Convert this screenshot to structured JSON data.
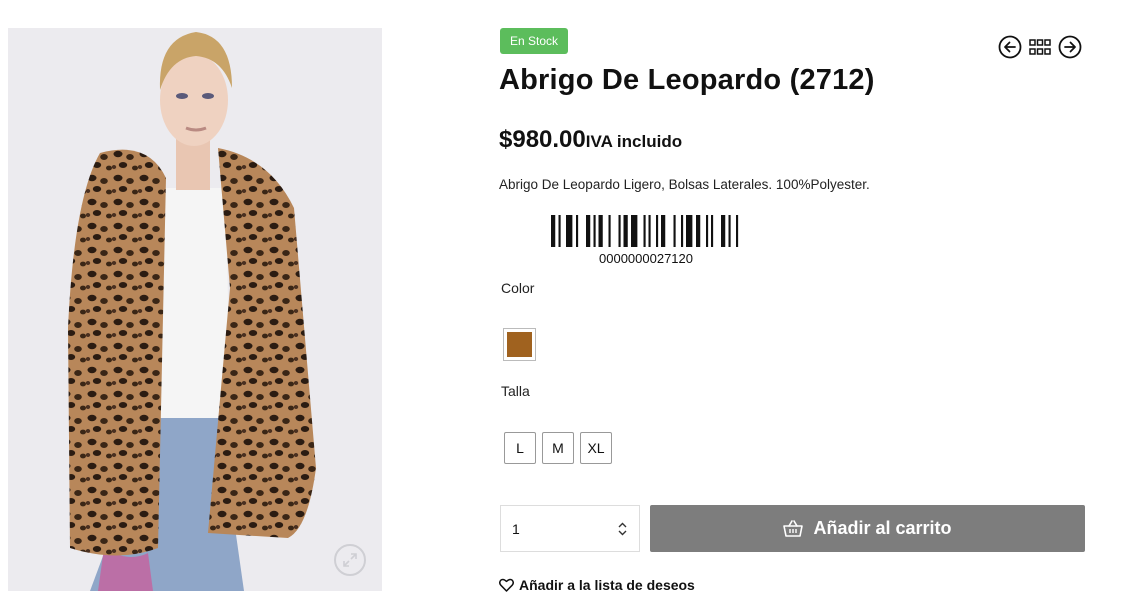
{
  "product": {
    "stock_badge": "En Stock",
    "title": "Abrigo De Leopardo (2712)",
    "price": "$980.00",
    "tax_note": "IVA incluido",
    "description": "Abrigo De Leopardo Ligero, Bolsas Laterales. 100%Polyester.",
    "barcode_number": "0000000027120"
  },
  "options": {
    "color_label": "Color",
    "color_swatch": "#a0621f",
    "size_label": "Talla",
    "sizes": [
      "L",
      "M",
      "XL"
    ]
  },
  "purchase": {
    "quantity": "1",
    "add_to_cart_label": "Añadir al carrito",
    "wishlist_label": "Añadir a la lista de deseos"
  },
  "colors": {
    "stock_badge": "#5cbd5c",
    "cart_button": "#7d7d7d"
  },
  "icons": {
    "zoom": "expand-icon",
    "nav_prev": "arrow-left-circle-icon",
    "nav_grid": "grid-icon",
    "nav_next": "arrow-right-circle-icon",
    "cart": "basket-icon",
    "wishlist": "heart-icon"
  }
}
